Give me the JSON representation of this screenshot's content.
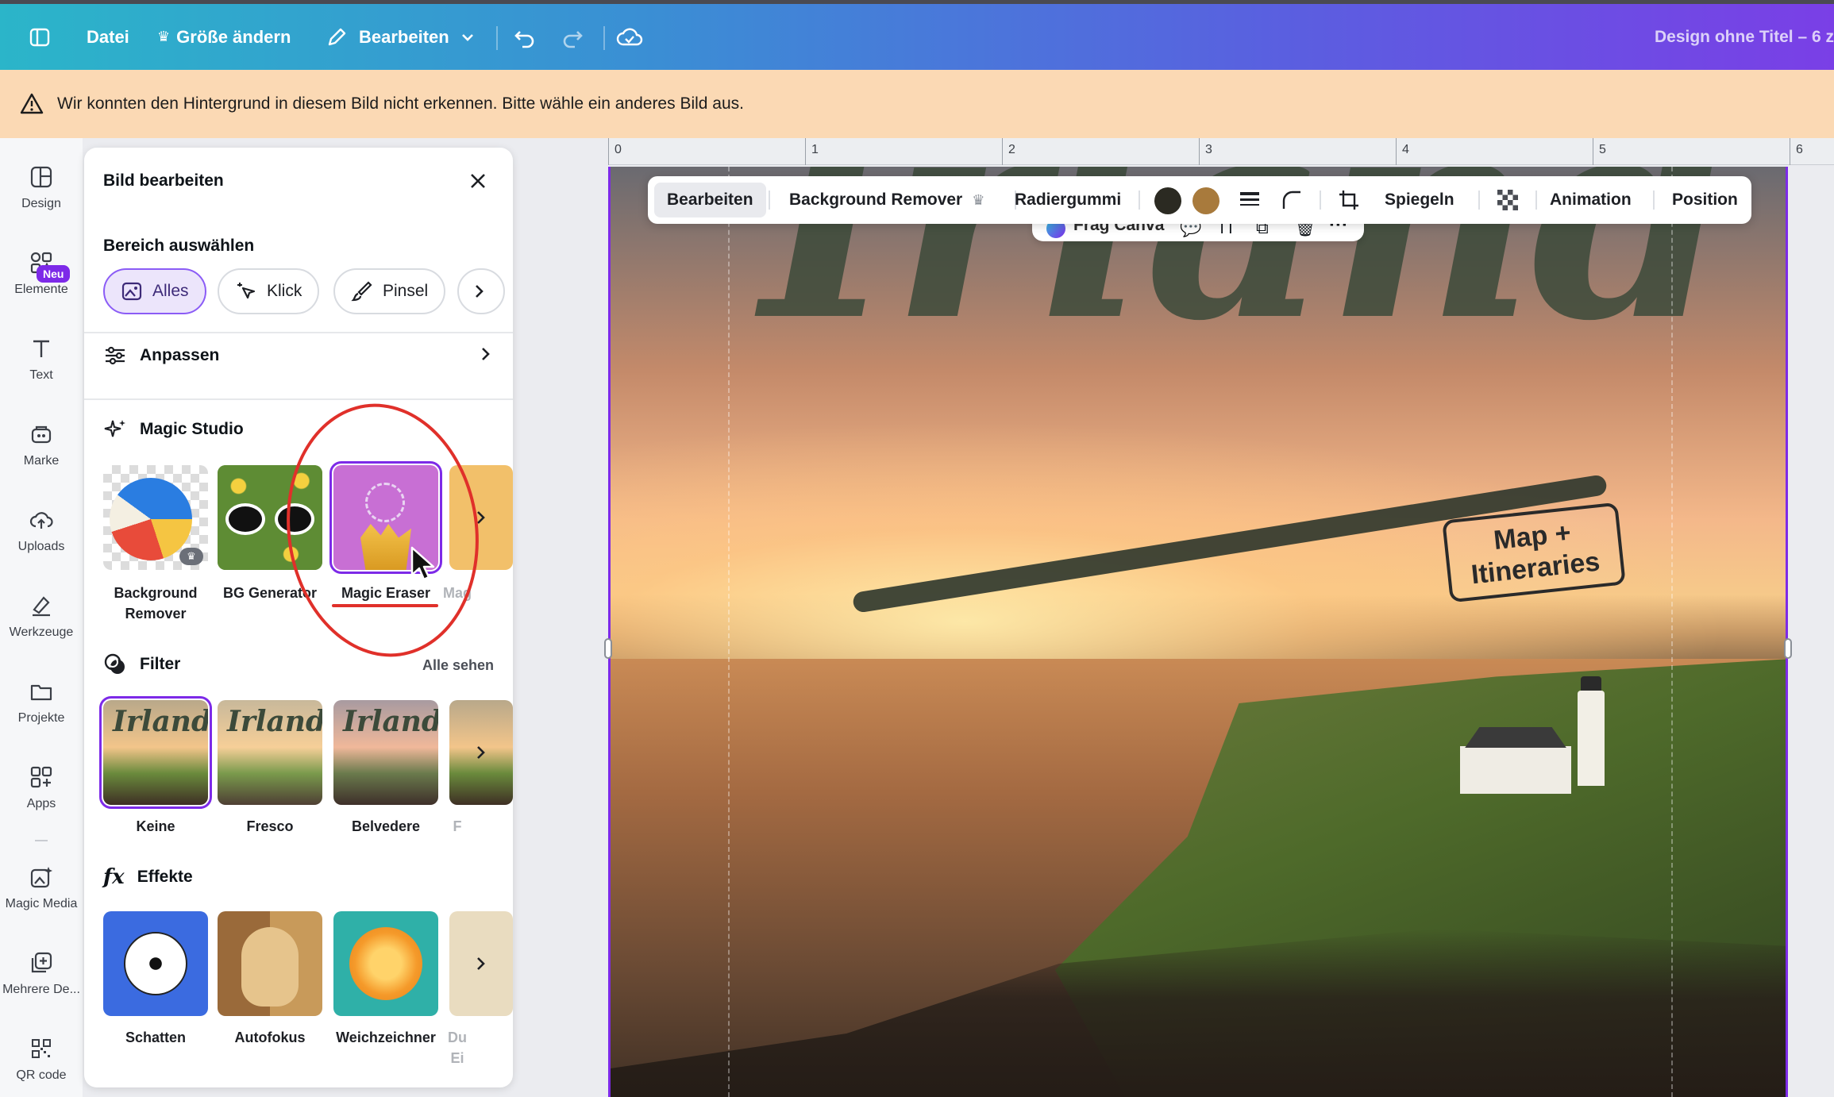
{
  "topbar": {
    "menu_file": "Datei",
    "menu_resize": "Größe ändern",
    "menu_edit": "Bearbeiten",
    "doc_title": "Design ohne Titel – 6 z"
  },
  "warning": {
    "text": "Wir konnten den Hintergrund in diesem Bild nicht erkennen. Bitte wähle ein anderes Bild aus."
  },
  "rail": {
    "items": [
      {
        "label": "Design",
        "icon": "layout-icon"
      },
      {
        "label": "Elemente",
        "icon": "shapes-icon"
      },
      {
        "label": "Text",
        "icon": "text-icon"
      },
      {
        "label": "Marke",
        "icon": "brand-icon"
      },
      {
        "label": "Uploads",
        "icon": "cloud-upload-icon"
      },
      {
        "label": "Werkzeuge",
        "icon": "pen-tool-icon"
      },
      {
        "label": "Projekte",
        "icon": "folder-icon"
      },
      {
        "label": "Apps",
        "icon": "apps-grid-icon"
      },
      {
        "label": "Magic Media",
        "icon": "magic-media-icon"
      },
      {
        "label": "Mehrere De...",
        "icon": "multi-design-icon"
      },
      {
        "label": "QR code",
        "icon": "qr-code-icon"
      }
    ],
    "new_badge": "Neu"
  },
  "panel": {
    "title": "Bild bearbeiten",
    "select_area_label": "Bereich auswählen",
    "chips": [
      "Alles",
      "Klick",
      "Pinsel"
    ],
    "adjust_label": "Anpassen",
    "magic_studio_label": "Magic Studio",
    "magic_tools": [
      "Background Remover",
      "BG Generator",
      "Magic Eraser",
      "Mag"
    ],
    "filter_label": "Filter",
    "see_all": "Alle sehen",
    "filters": [
      "Keine",
      "Fresco",
      "Belvedere",
      "F"
    ],
    "filter_thumb_text": "Irland",
    "effects_label": "Effekte",
    "effects": [
      "Schatten",
      "Autofokus",
      "Weichzeichner",
      "Du"
    ],
    "effects_more_line": "Ei"
  },
  "ruler": {
    "labels": [
      "0",
      "1",
      "2",
      "3",
      "4",
      "5",
      "6"
    ]
  },
  "toolbar": {
    "edit": "Bearbeiten",
    "bg_remover": "Background Remover",
    "eraser": "Radiergummi",
    "flip": "Spiegeln",
    "animation": "Animation",
    "position": "Position",
    "ask_canva": "Frag Canva",
    "swatch_colors": [
      "#2b2a22",
      "#a87a3c"
    ]
  },
  "canvas": {
    "headline": "Irland",
    "badge_line1": "Map +",
    "badge_line2": "Itineraries"
  },
  "colors": {
    "accent": "#7d2ae8",
    "warning_bg": "#fbd9b4",
    "annotation": "#e0302a"
  }
}
